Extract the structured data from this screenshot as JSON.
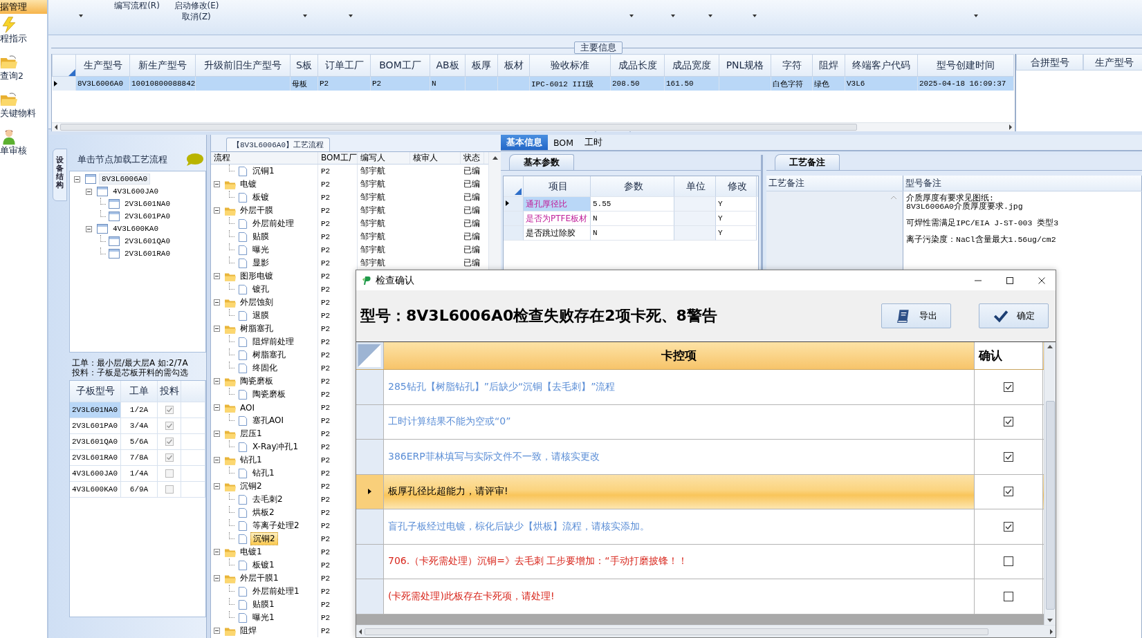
{
  "nav": {
    "header": "据管理",
    "items": [
      {
        "label": "程指示",
        "kind": "bolt"
      },
      {
        "label": "查询2",
        "kind": "folder"
      },
      {
        "label": "关键物料",
        "kind": "folder"
      },
      {
        "label": "单审核",
        "kind": "person"
      }
    ]
  },
  "toolbar": {
    "items": [
      {
        "label": "编写流程(R)"
      },
      {
        "label": "启动修改(E)",
        "sub": "取消(Z)"
      }
    ]
  },
  "main_info": {
    "title": "主要信息",
    "columns": [
      "生产型号",
      "新生产型号",
      "升级前旧生产型号",
      "S板",
      "订单工厂",
      "BOM工厂",
      "AB板",
      "板厚",
      "板材",
      "验收标准",
      "成品长度",
      "成品宽度",
      "PNL规格",
      "字符",
      "阻焊",
      "终端客户代码",
      "型号创建时间"
    ],
    "rows": [
      {
        "selected": true,
        "cells": [
          "8V3L6006A0",
          "10010800088842",
          "",
          "母板",
          "P2",
          "P2",
          "N",
          "",
          "",
          "IPC-6012 III级",
          "208.50",
          "161.50",
          "",
          "白色字符",
          "绿色",
          "V3L6",
          "2025-04-18 16:09:37"
        ]
      }
    ],
    "side_columns": [
      "合拼型号",
      "生产型号"
    ]
  },
  "structure_panel": {
    "tab": "设备结构",
    "hint": "单击节点加载工艺流程",
    "tree": [
      {
        "label": "8V3L6006A0",
        "selected": true,
        "expanded": true,
        "children": [
          {
            "label": "4V3L600JA0",
            "selected": false,
            "expanded": true,
            "children": [
              {
                "label": "2V3L601NA0",
                "selected": false
              },
              {
                "label": "2V3L601PA0",
                "selected": false
              }
            ]
          },
          {
            "label": "4V3L600KA0",
            "selected": false,
            "expanded": true,
            "children": [
              {
                "label": "2V3L601QA0",
                "selected": false
              },
              {
                "label": "2V3L601RA0",
                "selected": false
              }
            ]
          }
        ]
      }
    ],
    "notes": [
      "工单：最小层/最大层A 如:2/7A",
      "投料：子板是芯板开料的需勾选"
    ],
    "sub_boards": {
      "columns": [
        "子板型号",
        "工单",
        "投料"
      ],
      "rows": [
        {
          "model": "2V3L601NA0",
          "order": "1/2A",
          "feed": true,
          "selected": true
        },
        {
          "model": "2V3L601PA0",
          "order": "3/4A",
          "feed": true,
          "selected": false
        },
        {
          "model": "2V3L601QA0",
          "order": "5/6A",
          "feed": true,
          "selected": false
        },
        {
          "model": "2V3L601RA0",
          "order": "7/8A",
          "feed": true,
          "selected": false
        },
        {
          "model": "4V3L600JA0",
          "order": "1/4A",
          "feed": false,
          "selected": false
        },
        {
          "model": "4V3L600KA0",
          "order": "6/9A",
          "feed": false,
          "selected": false
        }
      ]
    }
  },
  "process_flow": {
    "title": "【8V3L6006A0】工艺流程",
    "columns": [
      "流程",
      "BOM工厂",
      "编写人",
      "核审人",
      "状态"
    ],
    "rows": [
      {
        "label": "沉铜1",
        "kind": "step",
        "bom": "P2",
        "writer": "邹宇航",
        "status": "已编",
        "selected": false
      },
      {
        "label": "电镀",
        "kind": "group",
        "bom": "P2",
        "writer": "邹宇航",
        "status": "已编",
        "selected": false,
        "expanded": true,
        "children": [
          {
            "label": "板镀",
            "kind": "step",
            "bom": "P2",
            "writer": "邹宇航",
            "status": "已编",
            "selected": false
          }
        ]
      },
      {
        "label": "外层干膜",
        "kind": "group",
        "bom": "P2",
        "writer": "邹宇航",
        "status": "已编",
        "selected": false,
        "expanded": true,
        "children": [
          {
            "label": "外层前处理",
            "kind": "step",
            "bom": "P2",
            "writer": "邹宇航",
            "status": "已编",
            "selected": false
          },
          {
            "label": "贴膜",
            "kind": "step",
            "bom": "P2",
            "writer": "邹宇航",
            "status": "已编",
            "selected": false
          },
          {
            "label": "曝光",
            "kind": "step",
            "bom": "P2",
            "writer": "邹宇航",
            "status": "已编",
            "selected": false
          },
          {
            "label": "显影",
            "kind": "step",
            "bom": "P2",
            "writer": "邹宇航",
            "status": "已编",
            "selected": false
          }
        ]
      },
      {
        "label": "图形电镀",
        "kind": "group",
        "bom": "P2",
        "selected": false,
        "expanded": true,
        "children": [
          {
            "label": "镀孔",
            "kind": "step",
            "bom": "P2",
            "selected": false
          }
        ]
      },
      {
        "label": "外层蚀刻",
        "kind": "group",
        "bom": "P2",
        "selected": false,
        "expanded": true,
        "children": [
          {
            "label": "退膜",
            "kind": "step",
            "bom": "P2",
            "selected": false
          }
        ]
      },
      {
        "label": "树脂塞孔",
        "kind": "group",
        "bom": "P2",
        "selected": false,
        "expanded": true,
        "children": [
          {
            "label": "阻焊前处理",
            "kind": "step",
            "bom": "P2",
            "selected": false
          },
          {
            "label": "树脂塞孔",
            "kind": "step",
            "bom": "P2",
            "selected": false
          },
          {
            "label": "终固化",
            "kind": "step",
            "bom": "P2",
            "selected": false
          }
        ]
      },
      {
        "label": "陶瓷磨板",
        "kind": "group",
        "bom": "P2",
        "selected": false,
        "expanded": true,
        "children": [
          {
            "label": "陶瓷磨板",
            "kind": "step",
            "bom": "P2",
            "selected": false
          }
        ]
      },
      {
        "label": "AOI",
        "kind": "group",
        "bom": "P2",
        "selected": false,
        "expanded": true,
        "children": [
          {
            "label": "塞孔AOI",
            "kind": "step",
            "bom": "P2",
            "selected": false
          }
        ]
      },
      {
        "label": "层压1",
        "kind": "group",
        "bom": "P2",
        "selected": false,
        "expanded": true,
        "children": [
          {
            "label": "X-Ray冲孔1",
            "kind": "step",
            "bom": "P2",
            "selected": false
          }
        ]
      },
      {
        "label": "钻孔1",
        "kind": "group",
        "bom": "P2",
        "selected": false,
        "expanded": true,
        "children": [
          {
            "label": "钻孔1",
            "kind": "step",
            "bom": "P2",
            "selected": false
          }
        ]
      },
      {
        "label": "沉铜2",
        "kind": "group",
        "bom": "P2",
        "selected": false,
        "expanded": true,
        "children": [
          {
            "label": "去毛刺2",
            "kind": "step",
            "bom": "P2",
            "selected": false
          },
          {
            "label": "烘板2",
            "kind": "step",
            "bom": "P2",
            "selected": false
          },
          {
            "label": "等离子处理2",
            "kind": "step",
            "bom": "P2",
            "selected": false
          },
          {
            "label": "沉铜2",
            "kind": "step",
            "bom": "P2",
            "selected": true
          }
        ]
      },
      {
        "label": "电镀1",
        "kind": "group",
        "bom": "P2",
        "selected": false,
        "expanded": true,
        "children": [
          {
            "label": "板镀1",
            "kind": "step",
            "bom": "P2",
            "selected": false
          }
        ]
      },
      {
        "label": "外层干膜1",
        "kind": "group",
        "bom": "P2",
        "selected": false,
        "expanded": true,
        "children": [
          {
            "label": "外层前处理1",
            "kind": "step",
            "bom": "P2",
            "selected": false
          },
          {
            "label": "贴膜1",
            "kind": "step",
            "bom": "P2",
            "selected": false
          },
          {
            "label": "曝光1",
            "kind": "step",
            "bom": "P2",
            "selected": false
          }
        ]
      },
      {
        "label": "阻焊",
        "kind": "group",
        "bom": "P2",
        "selected": false,
        "expanded": true
      }
    ]
  },
  "detail_tabs": [
    {
      "label": "基本信息",
      "selected": true
    },
    {
      "label": "BOM",
      "selected": false
    },
    {
      "label": "工时",
      "selected": false
    }
  ],
  "basic_params": {
    "title": "基本参数",
    "columns": [
      "项目",
      "参数",
      "单位",
      "修改"
    ],
    "rows": [
      {
        "item": "通孔厚径比",
        "kind": "flagged",
        "value": "5.55",
        "modified": "Y",
        "selected": true
      },
      {
        "item": "是否为PTFE板材",
        "kind": "flagged",
        "value": "N",
        "modified": "Y",
        "selected": false
      },
      {
        "item": "是否跳过除胶",
        "kind": "plain",
        "value": "N",
        "modified": "Y",
        "selected": false
      }
    ]
  },
  "remarks": {
    "title": "工艺备注",
    "columns": [
      "工艺备注",
      "型号备注"
    ],
    "notes": [
      "介质厚度有要求见图纸:\n8V3L6006A0介质厚度要求.jpg",
      "可焊性需满足IPC/EIA J-ST-003 类型3",
      "离子污染度：NaCl含量最大1.56ug/cm2"
    ]
  },
  "dialog": {
    "title": "检查确认",
    "heading": "型号：8V3L6006A0检查失败存在2项卡死、8警告",
    "buttons": [
      {
        "label": "导出",
        "kind": "export"
      },
      {
        "label": "确定",
        "kind": "confirm"
      }
    ],
    "columns": [
      "卡控项",
      "确认"
    ],
    "rows": [
      {
        "text": "285钻孔【树脂钻孔】”后缺少“沉铜【去毛刺】”流程",
        "kind": "warning",
        "checked": true,
        "selected": false
      },
      {
        "text": "工时计算结果不能为空或“0”",
        "kind": "warning",
        "checked": true,
        "selected": false
      },
      {
        "text": "386ERP菲林填写与实际文件不一致，请核实更改",
        "kind": "warning",
        "checked": true,
        "selected": false
      },
      {
        "text": "板厚孔径比超能力，请评审!",
        "kind": "warning",
        "checked": true,
        "selected": true
      },
      {
        "text": "盲孔子板经过电镀，棕化后缺少【烘板】流程，请核实添加。",
        "kind": "warning",
        "checked": true,
        "selected": false
      },
      {
        "text": "706.（卡死需处理）沉铜=》去毛刺 工步要增加：“手动打磨披锋！！",
        "kind": "blocking",
        "checked": false,
        "selected": false
      },
      {
        "text": "(卡死需处理)此板存在卡死项，请处理!",
        "kind": "blocking",
        "checked": false,
        "selected": false
      }
    ]
  }
}
